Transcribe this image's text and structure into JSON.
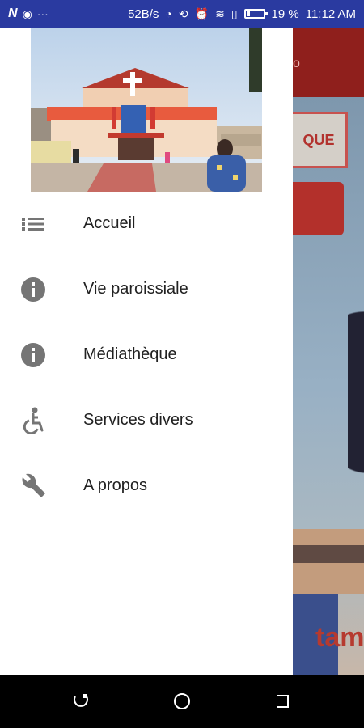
{
  "status_bar": {
    "carrier_icons": [
      "n-icon",
      "signal-icon",
      "more-icon"
    ],
    "more_glyph": "···",
    "network_speed": "52B/s",
    "battery_text": "19 %",
    "battery_level": 0.19,
    "time": "11:12 AM"
  },
  "background": {
    "header_fragment": "o",
    "button_fragment": "QUE",
    "bottom_text_fragment": "tam"
  },
  "drawer": {
    "header_image": "church-photo",
    "menu": [
      {
        "id": "accueil",
        "label": "Accueil",
        "icon": "list-icon"
      },
      {
        "id": "vie-paroissiale",
        "label": "Vie paroissiale",
        "icon": "info-icon"
      },
      {
        "id": "mediatheque",
        "label": "Médiathèque",
        "icon": "info-icon"
      },
      {
        "id": "services-divers",
        "label": "Services divers",
        "icon": "accessibility-icon"
      },
      {
        "id": "a-propos",
        "label": "A propos",
        "icon": "wrench-icon"
      }
    ]
  },
  "navigation": [
    "recent-apps-icon",
    "home-icon",
    "back-icon"
  ],
  "colors": {
    "status_bar": "#2a3aa0",
    "drawer_bg": "#ffffff",
    "icon": "#757575",
    "text": "#212121",
    "background_header": "#8f1f1c"
  }
}
